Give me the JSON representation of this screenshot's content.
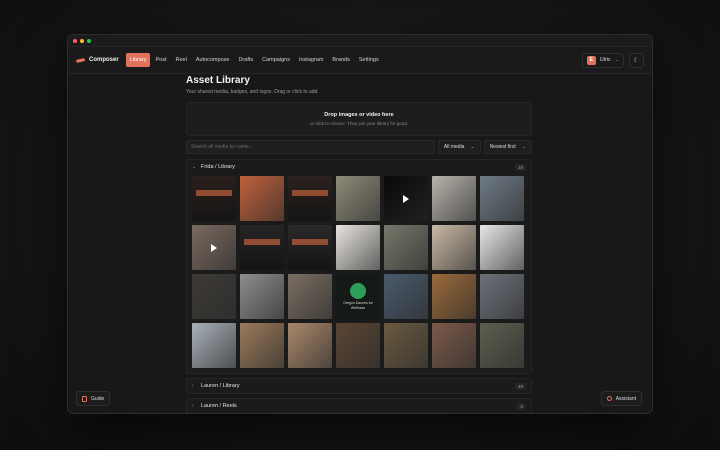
{
  "nav": {
    "brand": "Composer",
    "items": [
      "Library",
      "Post",
      "Reel",
      "Autocompose",
      "Drafts",
      "Campaigns",
      "Instagram",
      "Brands",
      "Settings"
    ],
    "active": "Library",
    "user": {
      "initial": "E",
      "name": "Ulric"
    }
  },
  "page": {
    "title": "Asset Library",
    "subtitle": "Your shared media, badges, and logos. Drag or click to add."
  },
  "dropzone": {
    "title": "Drop images or video here",
    "subtitle": "or click to choose. They join your library for good."
  },
  "filters": {
    "search_placeholder": "Search all media by name...",
    "media_type": "All media",
    "sort": "Newest first"
  },
  "groups": [
    {
      "name": "Frida / Library",
      "count": "28",
      "expanded": true
    },
    {
      "name": "Lauren / Library",
      "count": "48",
      "expanded": false
    },
    {
      "name": "Lauren / Reels",
      "count": "8",
      "expanded": false
    }
  ],
  "tiles": [
    {
      "kind": "screenshot",
      "color": "#2a201c"
    },
    {
      "kind": "photo",
      "color": "#c0613a"
    },
    {
      "kind": "screenshot",
      "color": "#2c221e"
    },
    {
      "kind": "photo",
      "color": "#8f8c7a"
    },
    {
      "kind": "video",
      "color": "#0a0a0a"
    },
    {
      "kind": "photo",
      "color": "#b7b3ac"
    },
    {
      "kind": "photo",
      "color": "#6f7b86"
    },
    {
      "kind": "video",
      "color": "#7a6a60"
    },
    {
      "kind": "screenshot",
      "color": "#262626"
    },
    {
      "kind": "screenshot",
      "color": "#2a2a2a"
    },
    {
      "kind": "photo",
      "color": "#e9e6e0"
    },
    {
      "kind": "photo",
      "color": "#76786a"
    },
    {
      "kind": "photo",
      "color": "#c9b9a6"
    },
    {
      "kind": "photo",
      "color": "#e8e8e8"
    },
    {
      "kind": "photo",
      "color": "#3d3a36"
    },
    {
      "kind": "photo",
      "color": "#8e8f8d"
    },
    {
      "kind": "photo",
      "color": "#7a6e62"
    },
    {
      "kind": "badge",
      "color": "#141a16"
    },
    {
      "kind": "photo",
      "color": "#4a5a6c"
    },
    {
      "kind": "photo",
      "color": "#9a6a3a"
    },
    {
      "kind": "photo",
      "color": "#6d727a"
    },
    {
      "kind": "photo",
      "color": "#a8b0b8"
    },
    {
      "kind": "photo",
      "color": "#9a7a5a"
    },
    {
      "kind": "photo",
      "color": "#a8876a"
    },
    {
      "kind": "photo",
      "color": "#5a4534"
    },
    {
      "kind": "photo",
      "color": "#6a5a40"
    },
    {
      "kind": "photo",
      "color": "#7c5a4a"
    },
    {
      "kind": "photo",
      "color": "#5b5f4e"
    }
  ],
  "badge_tile": {
    "label": "Oregon Dances for Wellness"
  },
  "footer": {
    "guide": "Guide",
    "assistant": "Assistant"
  },
  "colors": {
    "accent": "#e2725b",
    "background": "#181818"
  }
}
